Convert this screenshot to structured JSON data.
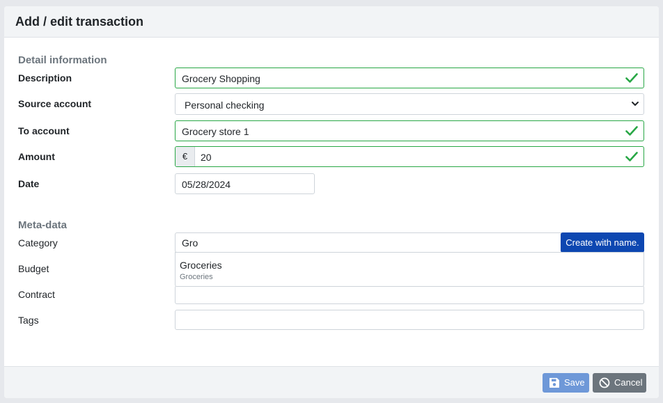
{
  "header": {
    "title": "Add / edit transaction"
  },
  "detail": {
    "section_title": "Detail information",
    "description": {
      "label": "Description",
      "value": "Grocery Shopping"
    },
    "source_account": {
      "label": "Source account",
      "value": "Personal checking"
    },
    "to_account": {
      "label": "To account",
      "value": "Grocery store 1"
    },
    "amount": {
      "label": "Amount",
      "currency": "€",
      "value": "20"
    },
    "date": {
      "label": "Date",
      "value": "05/28/2024"
    }
  },
  "meta": {
    "section_title": "Meta-data",
    "category": {
      "label": "Category",
      "value": "Gro",
      "create_label": "Create with name."
    },
    "suggestion": {
      "name": "Groceries",
      "sub": "Groceries"
    },
    "budget": {
      "label": "Budget",
      "value": ""
    },
    "contract": {
      "label": "Contract",
      "value": ""
    },
    "tags": {
      "label": "Tags",
      "value": ""
    }
  },
  "footer": {
    "save_label": "Save",
    "cancel_label": "Cancel"
  },
  "colors": {
    "valid": "#28a745",
    "primary": "#0d47b1",
    "save": "#6e98d8",
    "cancel": "#6c757d"
  },
  "icons": [
    "check-icon",
    "chevron-down-icon",
    "save-icon",
    "cancel-icon"
  ]
}
